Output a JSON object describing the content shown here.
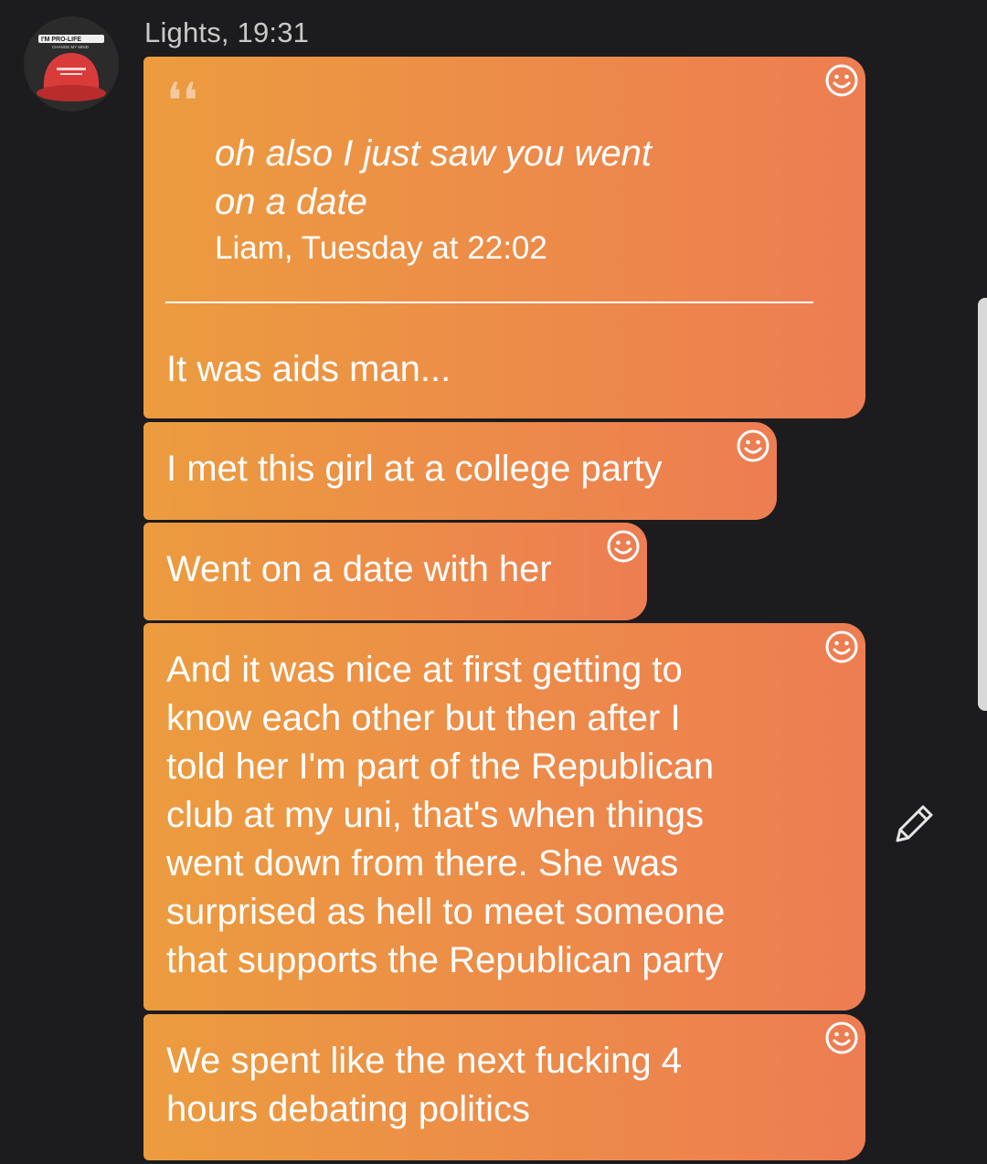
{
  "header": {
    "sender_line": "Lights, 19:31",
    "avatar_icon": "avatar-pro-life-hat",
    "avatar_lines": [
      "I'M PRO-LIFE",
      "CHANGE MY MIND"
    ]
  },
  "messages": [
    {
      "quoted": {
        "text": "oh also I just saw you went\non a date",
        "meta": "Liam, Tuesday at 22:02"
      },
      "text": "It was aids man..."
    },
    {
      "text": "I met this girl at a college party"
    },
    {
      "text": "Went on a date with her"
    },
    {
      "text": "And it was nice at first getting to\nknow each other but then after I\ntold her I'm part of the Republican\nclub at my uni, that's when things\nwent down from there. She was\nsurprised as hell to meet someone\nthat supports the Republican party"
    },
    {
      "text": "We spent like the next fucking 4\nhours debating politics"
    }
  ],
  "icons": {
    "reaction": "smiley-icon",
    "edit": "pencil-icon",
    "quote": "quote-icon"
  },
  "colors": {
    "background": "#1c1c1e",
    "bubble_start": "#ec9c3f",
    "bubble_end": "#ed7d52"
  }
}
